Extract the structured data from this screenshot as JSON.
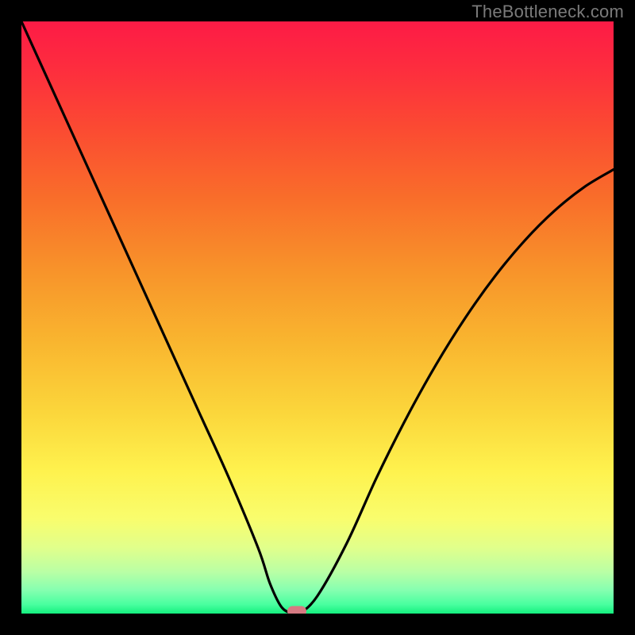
{
  "watermark": "TheBottleneck.com",
  "chart_data": {
    "type": "line",
    "title": "",
    "xlabel": "",
    "ylabel": "",
    "xlim": [
      0,
      100
    ],
    "ylim": [
      0,
      100
    ],
    "grid": false,
    "legend": false,
    "background": {
      "type": "vertical_gradient",
      "top_color": "#fd1b46",
      "mid_color": "#fbd63b",
      "bottom_color": "#14ef7e"
    },
    "series": [
      {
        "name": "bottleneck-curve",
        "color": "#000000",
        "x": [
          0,
          5,
          10,
          15,
          20,
          25,
          30,
          35,
          40,
          42,
          44,
          46,
          47,
          50,
          55,
          60,
          65,
          70,
          75,
          80,
          85,
          90,
          95,
          100
        ],
        "y": [
          100,
          89,
          78,
          67,
          56,
          45,
          34,
          23,
          11,
          5,
          1,
          0,
          0,
          3,
          12,
          23,
          33,
          42,
          50,
          57,
          63,
          68,
          72,
          75
        ]
      }
    ],
    "marker": {
      "x": 46.5,
      "y": 0.4,
      "color": "#d67a82",
      "shape": "rounded-rect"
    }
  }
}
